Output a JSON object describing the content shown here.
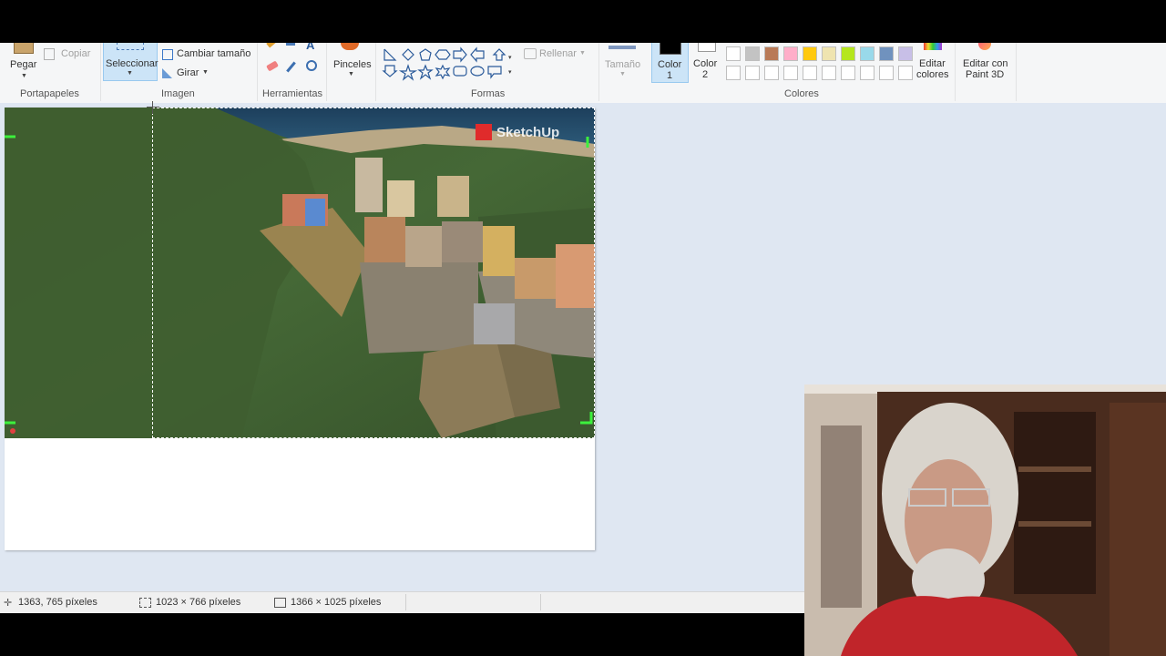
{
  "ribbon": {
    "clipboard": {
      "paste_label": "Pegar",
      "copy_label": "Copiar",
      "group_label": "Portapapeles"
    },
    "image": {
      "select_label": "Seleccionar",
      "resize_label": "Cambiar tamaño",
      "rotate_label": "Girar",
      "group_label": "Imagen"
    },
    "tools": {
      "group_label": "Herramientas"
    },
    "brushes": {
      "label": "Pinceles"
    },
    "shapes": {
      "fill_label": "Rellenar",
      "group_label": "Formas"
    },
    "size": {
      "label": "Tamaño"
    },
    "colors": {
      "color1_label": "Color",
      "color1_num": "1",
      "color2_label": "Color",
      "color2_num": "2",
      "edit_colors_label1": "Editar",
      "edit_colors_label2": "colores",
      "group_label": "Colores",
      "palette_row1": [
        "#ffffff",
        "#c3c3c3",
        "#b97a57",
        "#ffaec9",
        "#ffc90e",
        "#efe4b0",
        "#b5e61d",
        "#99d9ea",
        "#7092be",
        "#c8bfe7"
      ],
      "palette_row2": [
        "#ffffff",
        "#ffffff",
        "#ffffff",
        "#ffffff",
        "#ffffff",
        "#ffffff",
        "#ffffff",
        "#ffffff",
        "#ffffff",
        "#ffffff"
      ]
    },
    "paint3d": {
      "label1": "Editar con",
      "label2": "Paint 3D"
    }
  },
  "canvas": {
    "watermark": "SketchUp"
  },
  "status": {
    "cursor_pos": "1363, 765 píxeles",
    "selection_size": "1023 × 766 píxeles",
    "image_size": "1366 × 1025 píxeles"
  }
}
